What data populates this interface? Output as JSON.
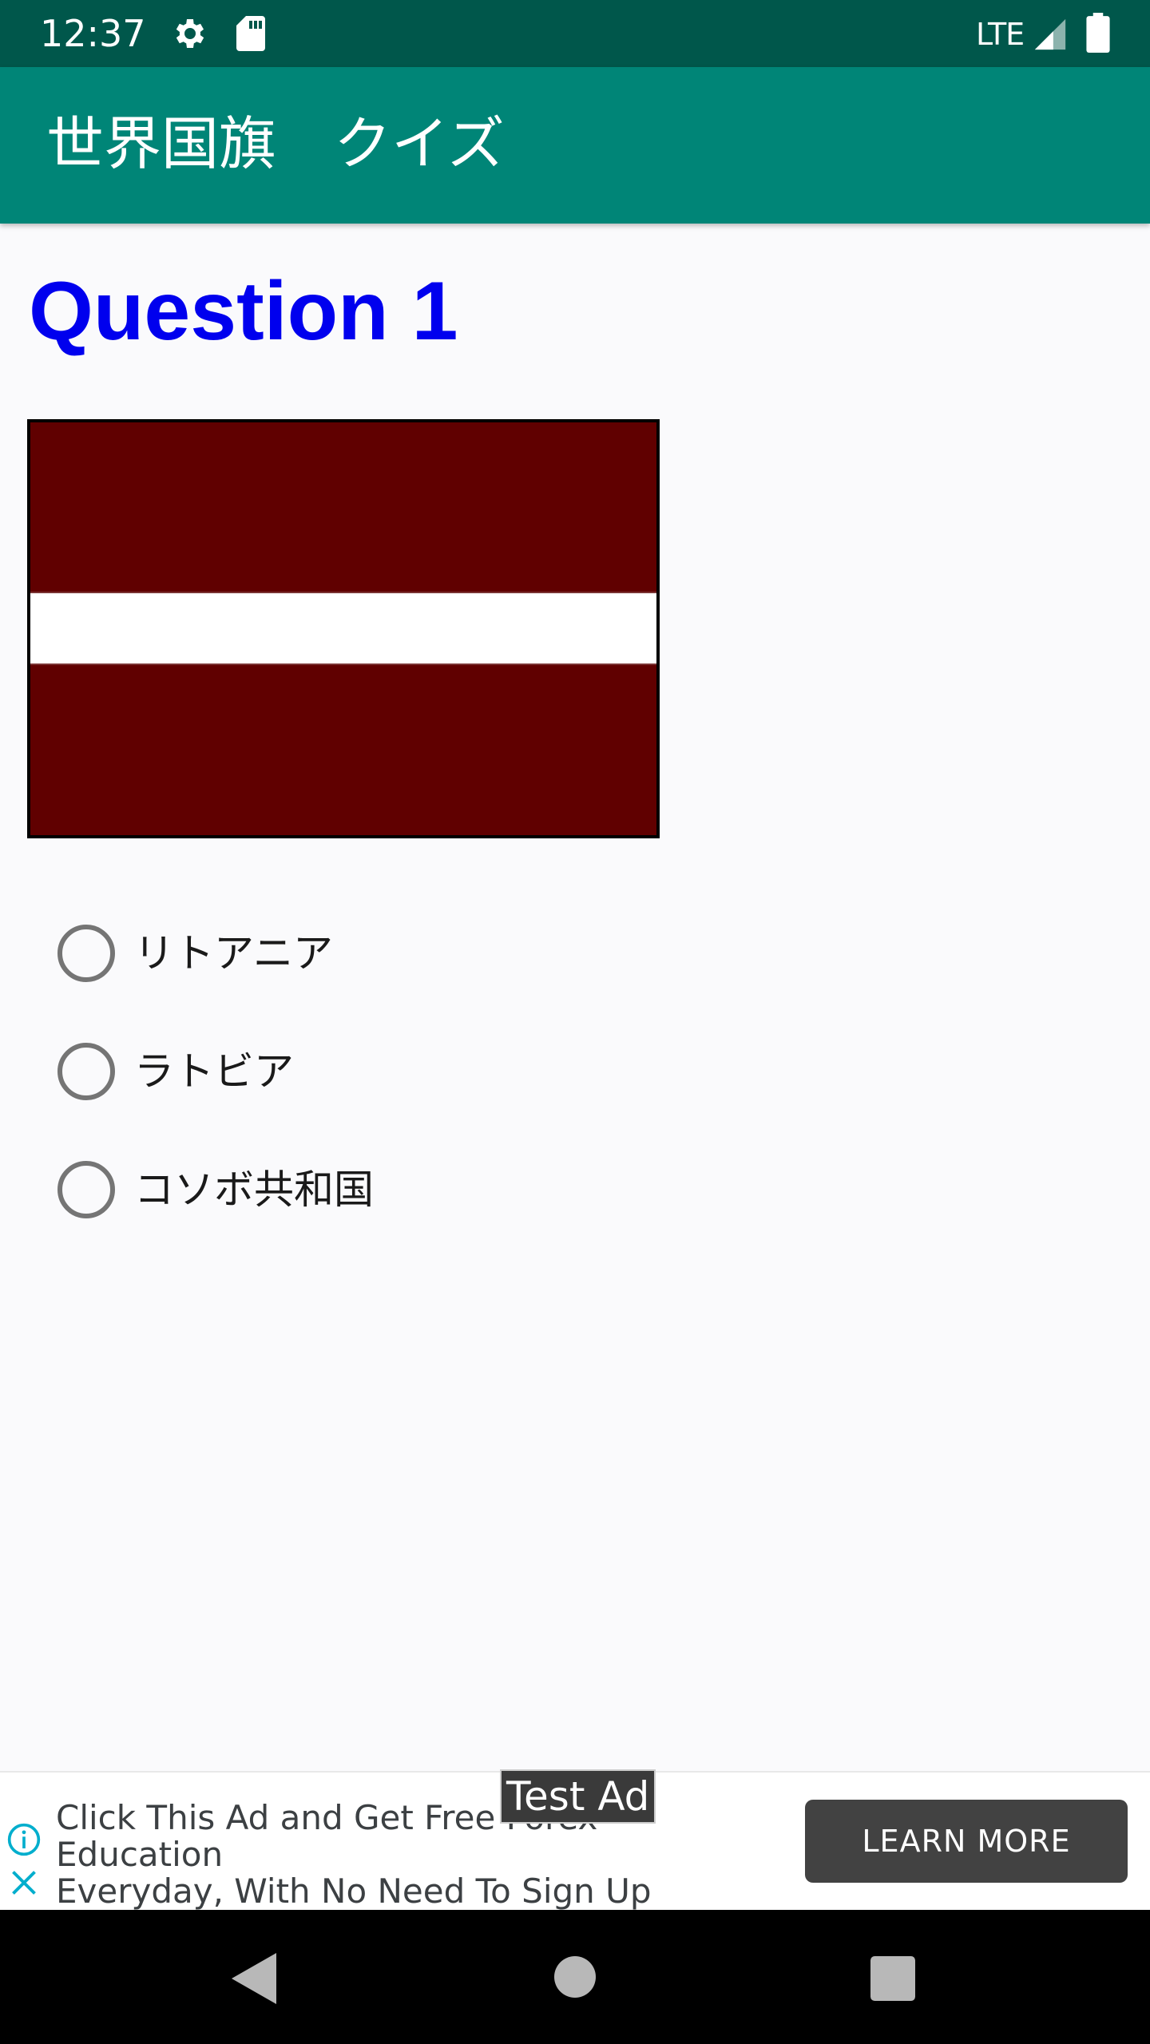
{
  "status_bar": {
    "time": "12:37",
    "network": "LTE",
    "icons": [
      "gear-icon",
      "sd-card-icon",
      "signal-icon",
      "battery-icon"
    ]
  },
  "app_bar": {
    "title": "世界国旗　クイズ",
    "color": "#008577"
  },
  "question": {
    "title": "Question 1",
    "title_color": "#0000ee",
    "flag": {
      "field_color": "#600000",
      "stripe_color": "#ffffff"
    },
    "options": [
      {
        "label": "リトアニア",
        "selected": false
      },
      {
        "label": "ラトビア",
        "selected": false
      },
      {
        "label": "コソボ共和国",
        "selected": false
      }
    ]
  },
  "ad": {
    "text_line1": "Click This Ad and Get Free Forex Education",
    "text_line2": "Everyday, With No Need To Sign Up",
    "test_label": "Test Ad",
    "button_label": "LEARN MORE"
  },
  "nav_bar": {
    "icons": [
      "back-icon",
      "home-icon",
      "recents-icon"
    ]
  }
}
